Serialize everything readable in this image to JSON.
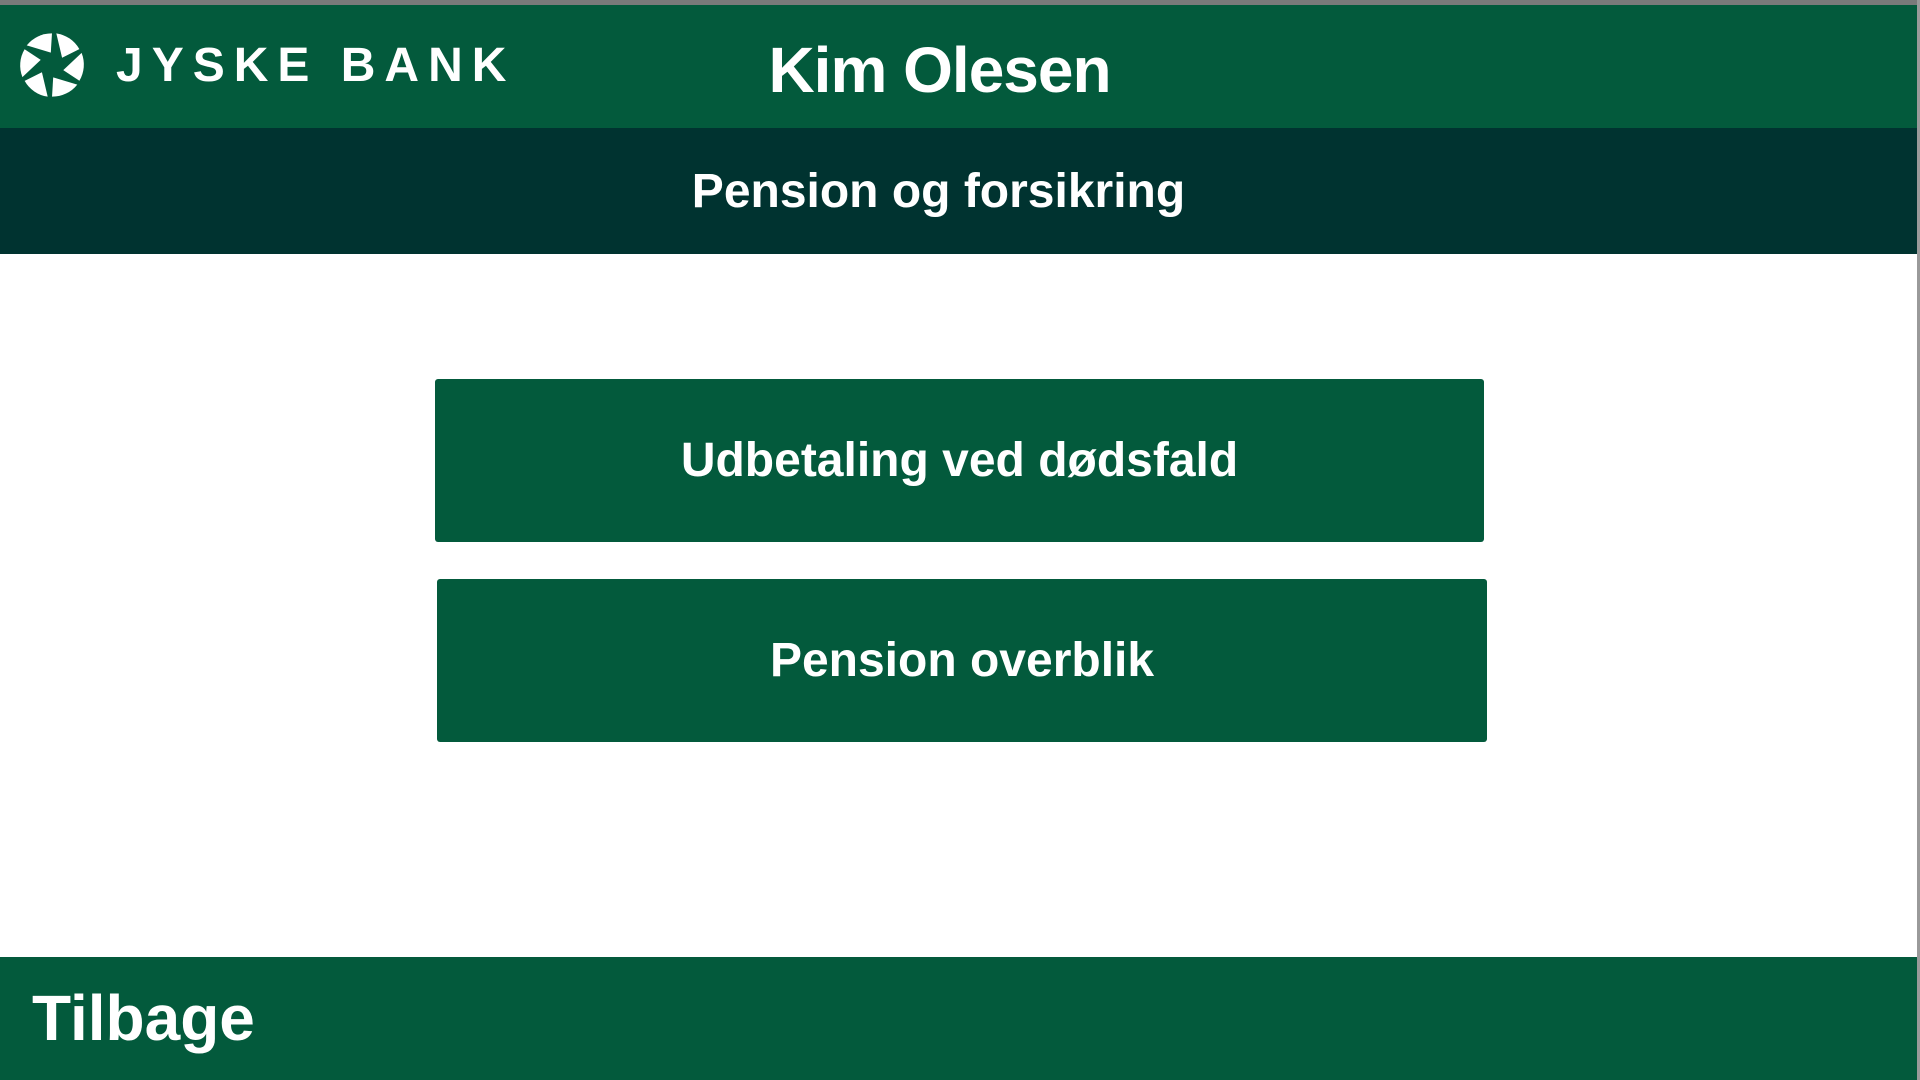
{
  "colors": {
    "brand": "#035a3c",
    "subheader": "#003330",
    "text": "#ffffff"
  },
  "header": {
    "logo_text": "JYSKE BANK",
    "logo_icon": "jyske-bank-logo-icon",
    "user_name": "Kim Olesen"
  },
  "subheader": {
    "title": "Pension og forsikring"
  },
  "menu": {
    "items": [
      {
        "label": "Udbetaling ved dødsfald"
      },
      {
        "label": "Pension overblik"
      }
    ]
  },
  "footer": {
    "back_label": "Tilbage"
  }
}
